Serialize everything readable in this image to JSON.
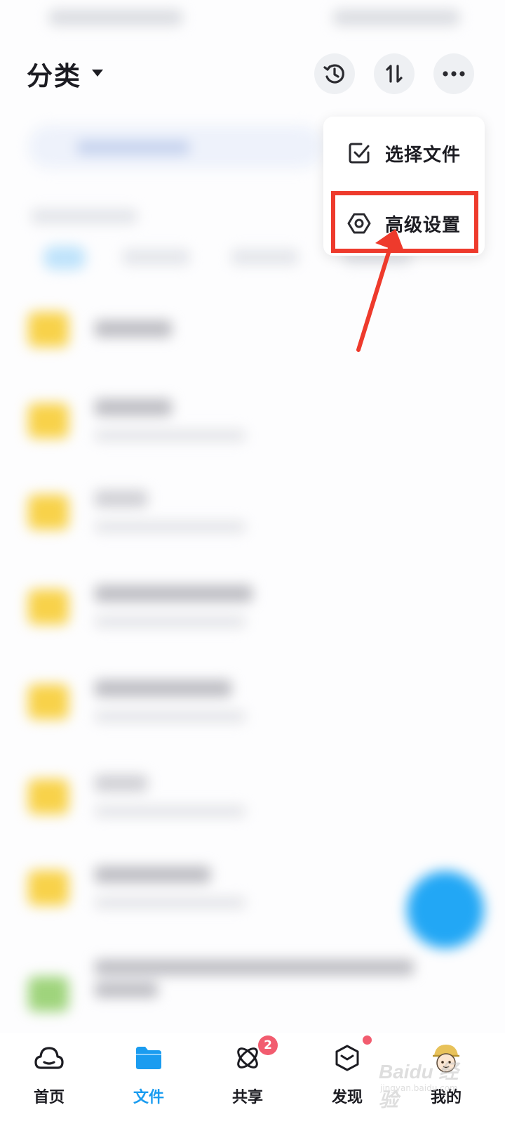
{
  "header": {
    "title": "分类"
  },
  "menu": {
    "items": [
      {
        "label": "选择文件",
        "icon": "checkbox-icon"
      },
      {
        "label": "高级设置",
        "icon": "hexagon-settings-icon"
      }
    ],
    "highlight_color": "#ee3a2c"
  },
  "tabs": [
    {
      "label": "首页",
      "icon": "cloud-home-icon"
    },
    {
      "label": "文件",
      "icon": "folder-icon",
      "active": true
    },
    {
      "label": "共享",
      "icon": "atom-share-icon",
      "badge": "2"
    },
    {
      "label": "发现",
      "icon": "cube-discover-icon"
    },
    {
      "label": "我的",
      "icon": "avatar-icon"
    }
  ],
  "watermark": {
    "text": "Baidu 经验",
    "subtext": "jingyan.baidu.com"
  },
  "colors": {
    "accent": "#1a9cf0",
    "folder": "#f8d24a",
    "badge": "#f25c6f",
    "fab": "#22a7f5"
  }
}
